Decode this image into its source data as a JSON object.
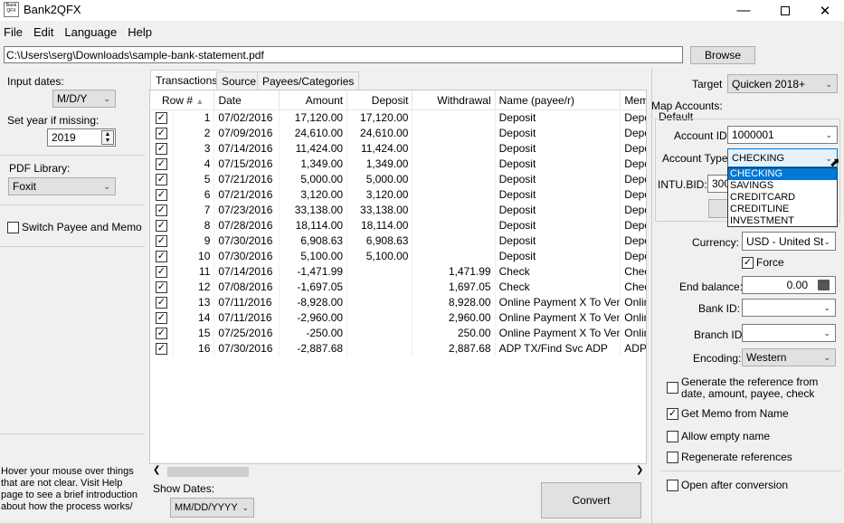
{
  "window": {
    "title": "Bank2QFX",
    "icon_text_top": "Bank",
    "icon_text_bottom": "QFX",
    "minimize_icon": "minimize-icon",
    "maximize_icon": "maximize-icon",
    "close_icon": "close-icon"
  },
  "menu": [
    "File",
    "Edit",
    "Language",
    "Help"
  ],
  "path": {
    "value": "C:\\Users\\serg\\Downloads\\sample-bank-statement.pdf",
    "browse_label": "Browse"
  },
  "left": {
    "input_dates_label": "Input dates:",
    "input_dates_value": "M/D/Y",
    "set_year_label": "Set year if missing:",
    "set_year_value": "2019",
    "pdf_library_label": "PDF Library:",
    "pdf_library_value": "Foxit",
    "switch_payee_label": "Switch Payee and Memo",
    "switch_payee_checked": false,
    "help_text": "Hover your mouse over things that are not clear. Visit Help page to see a brief introduction about how the process works/"
  },
  "tabs": [
    "Transactions",
    "Source",
    "Payees/Categories"
  ],
  "table": {
    "headers": [
      "Row #",
      "Date",
      "Amount",
      "Deposit",
      "Withdrawal",
      "Name (payee/r)",
      "Mem"
    ],
    "rows": [
      {
        "n": "1",
        "date": "07/02/2016",
        "amount": "17,120.00",
        "deposit": "17,120.00",
        "withdrawal": "",
        "name": "Deposit",
        "memo": "Depo"
      },
      {
        "n": "2",
        "date": "07/09/2016",
        "amount": "24,610.00",
        "deposit": "24,610.00",
        "withdrawal": "",
        "name": "Deposit",
        "memo": "Depo"
      },
      {
        "n": "3",
        "date": "07/14/2016",
        "amount": "11,424.00",
        "deposit": "11,424.00",
        "withdrawal": "",
        "name": "Deposit",
        "memo": "Depo"
      },
      {
        "n": "4",
        "date": "07/15/2016",
        "amount": "1,349.00",
        "deposit": "1,349.00",
        "withdrawal": "",
        "name": "Deposit",
        "memo": "Depo"
      },
      {
        "n": "5",
        "date": "07/21/2016",
        "amount": "5,000.00",
        "deposit": "5,000.00",
        "withdrawal": "",
        "name": "Deposit",
        "memo": "Depo"
      },
      {
        "n": "6",
        "date": "07/21/2016",
        "amount": "3,120.00",
        "deposit": "3,120.00",
        "withdrawal": "",
        "name": "Deposit",
        "memo": "Depo"
      },
      {
        "n": "7",
        "date": "07/23/2016",
        "amount": "33,138.00",
        "deposit": "33,138.00",
        "withdrawal": "",
        "name": "Deposit",
        "memo": "Depo"
      },
      {
        "n": "8",
        "date": "07/28/2016",
        "amount": "18,114.00",
        "deposit": "18,114.00",
        "withdrawal": "",
        "name": "Deposit",
        "memo": "Depo"
      },
      {
        "n": "9",
        "date": "07/30/2016",
        "amount": "6,908.63",
        "deposit": "6,908.63",
        "withdrawal": "",
        "name": "Deposit",
        "memo": "Depo"
      },
      {
        "n": "10",
        "date": "07/30/2016",
        "amount": "5,100.00",
        "deposit": "5,100.00",
        "withdrawal": "",
        "name": "Deposit",
        "memo": "Depo"
      },
      {
        "n": "11",
        "date": "07/14/2016",
        "amount": "-1,471.99",
        "deposit": "",
        "withdrawal": "1,471.99",
        "name": "Check",
        "memo": "Chec"
      },
      {
        "n": "12",
        "date": "07/08/2016",
        "amount": "-1,697.05",
        "deposit": "",
        "withdrawal": "1,697.05",
        "name": "Check",
        "memo": "Chec"
      },
      {
        "n": "13",
        "date": "07/11/2016",
        "amount": "-8,928.00",
        "deposit": "",
        "withdrawal": "8,928.00",
        "name": "Online Payment X To Vendor",
        "memo": "Onlin"
      },
      {
        "n": "14",
        "date": "07/11/2016",
        "amount": "-2,960.00",
        "deposit": "",
        "withdrawal": "2,960.00",
        "name": "Online Payment X To Vendor",
        "memo": "Onlin"
      },
      {
        "n": "15",
        "date": "07/25/2016",
        "amount": "-250.00",
        "deposit": "",
        "withdrawal": "250.00",
        "name": "Online Payment X To Vendor",
        "memo": "Onlin"
      },
      {
        "n": "16",
        "date": "07/30/2016",
        "amount": "-2,887.68",
        "deposit": "",
        "withdrawal": "2,887.68",
        "name": "ADP TX/Find Svc ADP",
        "memo": "ADP T"
      }
    ]
  },
  "bottom": {
    "show_dates_label": "Show Dates:",
    "show_dates_value": "MM/DD/YYYY",
    "convert_label": "Convert"
  },
  "right": {
    "target_label": "Target",
    "target_value": "Quicken 2018+",
    "map_accounts_label": "Map Accounts:",
    "default_label": "Default",
    "account_id_label": "Account ID:",
    "account_id_value": "1000001",
    "account_type_label": "Account Type:",
    "account_type_value": "CHECKING",
    "account_type_options": [
      "CHECKING",
      "SAVINGS",
      "CREDITCARD",
      "CREDITLINE",
      "INVESTMENT"
    ],
    "intu_bid_label": "INTU.BID:",
    "intu_bid_value": "300",
    "currency_label": "Currency:",
    "currency_value": "USD - United Sta",
    "force_label": "Force",
    "end_balance_label": "End balance:",
    "end_balance_value": "0.00",
    "bank_id_label": "Bank ID:",
    "branch_id_label": "Branch ID",
    "encoding_label": "Encoding:",
    "encoding_value": "Western",
    "generate_ref_label": "Generate the reference from date, amount, payee, check",
    "get_memo_label": "Get Memo from Name",
    "allow_empty_label": "Allow empty name",
    "regenerate_label": "Regenerate references",
    "open_after_label": "Open after conversion"
  },
  "colors": {
    "selection": "#0078d7",
    "window_bg": "#f0f0f0"
  }
}
